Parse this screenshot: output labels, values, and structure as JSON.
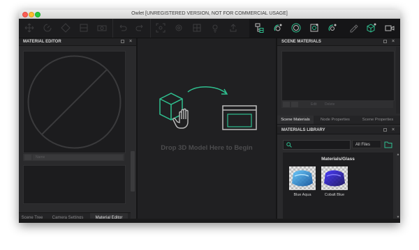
{
  "window": {
    "title": "Owlet [UNREGISTERED VERSION, NOT FOR COMMERCIAL USAGE]"
  },
  "colors": {
    "accent": "#2fbf8f",
    "background": "#202022",
    "panel": "#2a2a2c"
  },
  "toolbar": {
    "icons": [
      "move-icon",
      "rotate-icon",
      "scale-icon",
      "snap-icon",
      "camera-icon",
      "undo-icon",
      "redo-icon",
      "fit-icon",
      "settings-icon",
      "grid-icon",
      "light-icon",
      "export-icon",
      "scene-tree-icon",
      "material-icon",
      "environment-icon",
      "render-icon",
      "camera-settings-icon",
      "cube-add-icon",
      "video-icon"
    ]
  },
  "left": {
    "header": "MATERIAL EDITOR",
    "name_placeholder": "Name",
    "tabs": [
      "Scene Tree",
      "Camera Settings",
      "Material Editor"
    ],
    "active_tab": "Material Editor"
  },
  "center": {
    "drop_text": "Drop 3D Model Here to Begin"
  },
  "right": {
    "scene_header": "SCENE MATERIALS",
    "scene_actions": [
      "Edit",
      "Delete"
    ],
    "tabs": [
      "Scene Materials",
      "Node Properties",
      "Scene Properties"
    ],
    "active_tab": "Scene Materials",
    "library_header": "MATERIALS LIBRARY",
    "search_placeholder": "",
    "filter_value": "All Files",
    "library_title": "Materials/Glass",
    "materials": [
      {
        "name": "Blue Aqua"
      },
      {
        "name": "Cobalt Blue"
      }
    ]
  }
}
